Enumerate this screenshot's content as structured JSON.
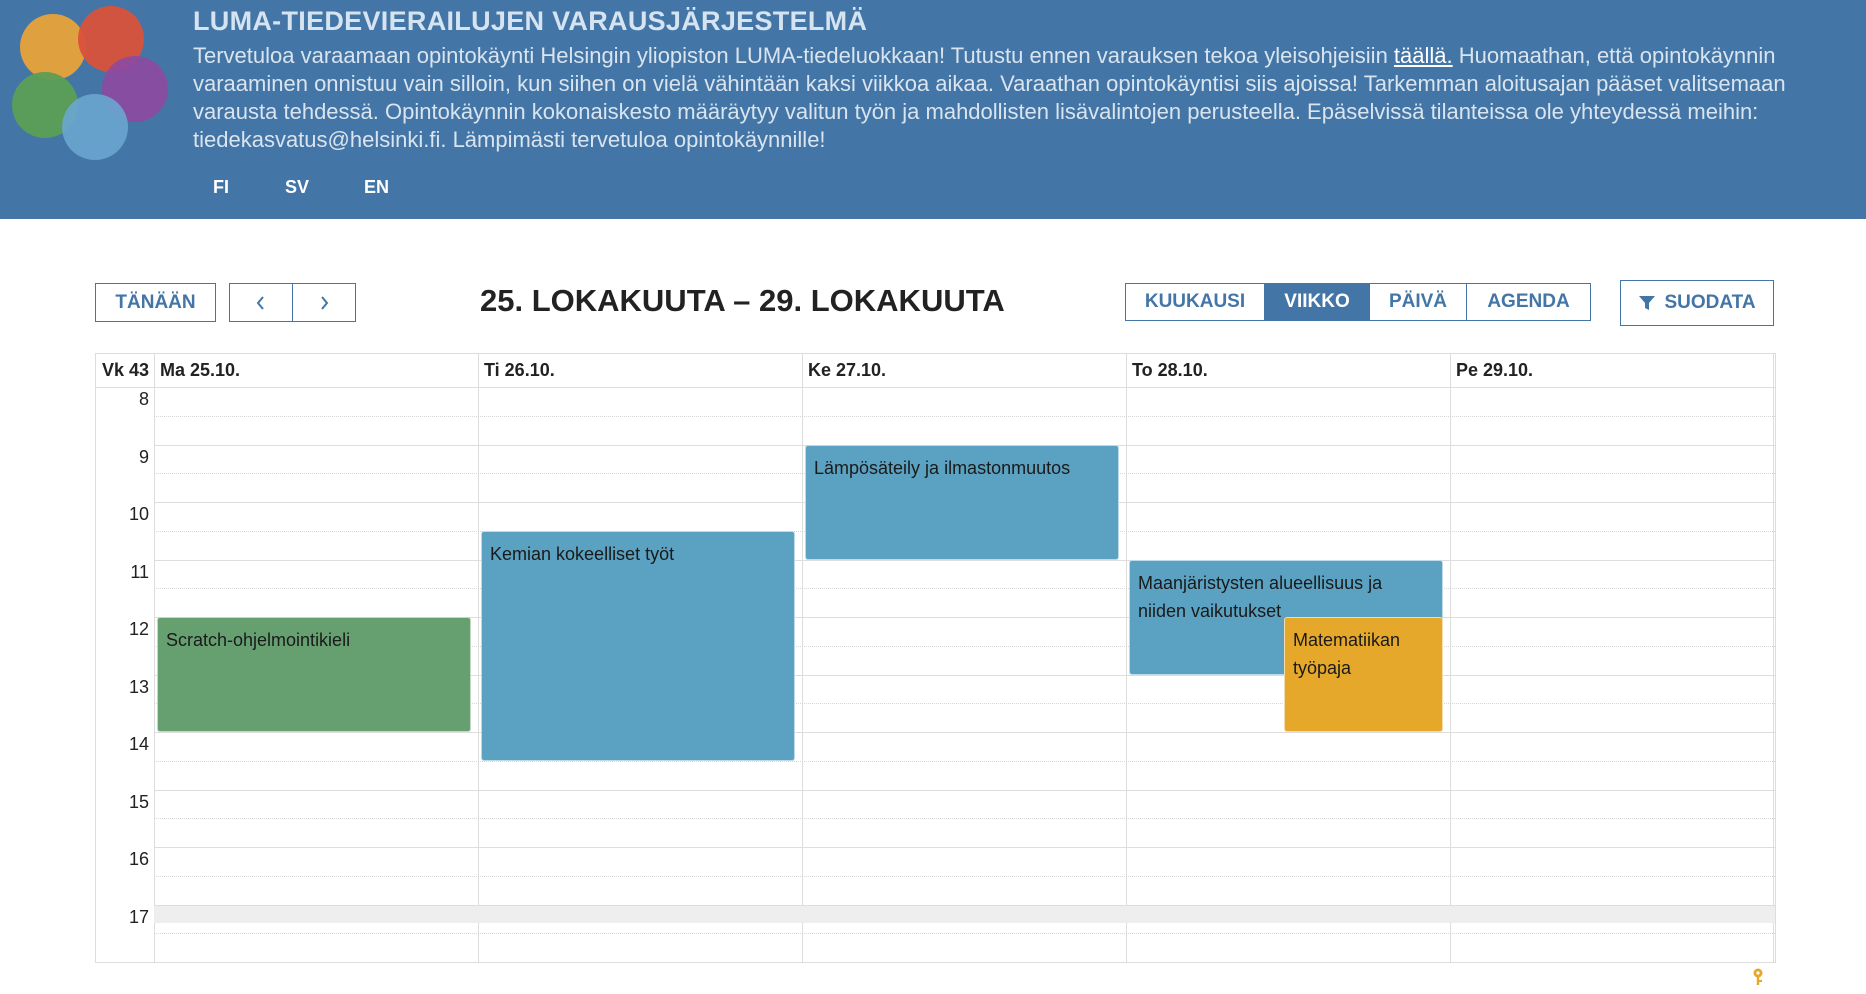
{
  "header": {
    "title": "LUMA-TIEDEVIERAILUJEN VARAUSJÄRJESTELMÄ",
    "intro_part1": "Tervetuloa varaamaan opintokäynti Helsingin yliopiston LUMA-tiedeluokkaan! Tutustu ennen varauksen tekoa yleisohjeisiin ",
    "intro_link": "täällä.",
    "intro_part2": " Huomaathan, että opintokäynnin varaaminen onnistuu vain silloin, kun siihen on vielä vähintään kaksi viikkoa aikaa. Varaathan opintokäyntisi siis ajoissa! Tarkemman aloitusajan pääset valitsemaan varausta tehdessä. Opintokäynnin kokonaiskesto määräytyy valitun työn ja mahdollisten lisävalintojen perusteella. Epäselvissä tilanteissa ole yhteydessä meihin: tiedekasvatus@helsinki.fi. Lämpimästi tervetuloa opintokäynnille!",
    "languages": [
      "FI",
      "SV",
      "EN"
    ],
    "logo_colors": [
      "#e8a23a",
      "#d9523a",
      "#8d4aa0",
      "#5c9e55",
      "#6aa6cf"
    ]
  },
  "toolbar": {
    "today_label": "TÄNÄÄN",
    "prev_icon": "chevron-left-icon",
    "next_icon": "chevron-right-icon",
    "range_title": "25. LOKAKUUTA – 29. LOKAKUUTA",
    "views": [
      "KUUKAUSI",
      "VIIKKO",
      "PÄIVÄ",
      "AGENDA"
    ],
    "active_view": "VIIKKO",
    "filter_label": "SUODATA",
    "filter_icon": "filter-icon"
  },
  "calendar": {
    "week_label": "Vk 43",
    "days": [
      "Ma 25.10.",
      "Ti 26.10.",
      "Ke 27.10.",
      "To 28.10.",
      "Pe 29.10."
    ],
    "hours": [
      "8",
      "9",
      "10",
      "11",
      "12",
      "13",
      "14",
      "15",
      "16",
      "17"
    ],
    "events": [
      {
        "title": "Scratch-ohjelmointikieli",
        "day": 0,
        "start": 12.0,
        "end": 14.0,
        "color": "#66a070"
      },
      {
        "title": "Kemian kokeelliset työt",
        "day": 1,
        "start": 10.5,
        "end": 14.5,
        "color": "#5ba2c2"
      },
      {
        "title": "Lämpösäteily ja ilmastonmuutos",
        "day": 2,
        "start": 9.0,
        "end": 11.0,
        "color": "#5ba2c2"
      },
      {
        "title": "Maanjäristysten alueellisuus ja niiden vaikutukset",
        "day": 3,
        "start": 11.0,
        "end": 13.0,
        "color": "#5ba2c2"
      },
      {
        "title": "Matematiikan työpaja",
        "day": 3,
        "start": 12.0,
        "end": 14.0,
        "color": "#e5a82b",
        "overlap": true
      }
    ]
  },
  "colors": {
    "header_bg": "#4376a6",
    "accent": "#4376a6",
    "key_icon": "#e5a82b"
  }
}
